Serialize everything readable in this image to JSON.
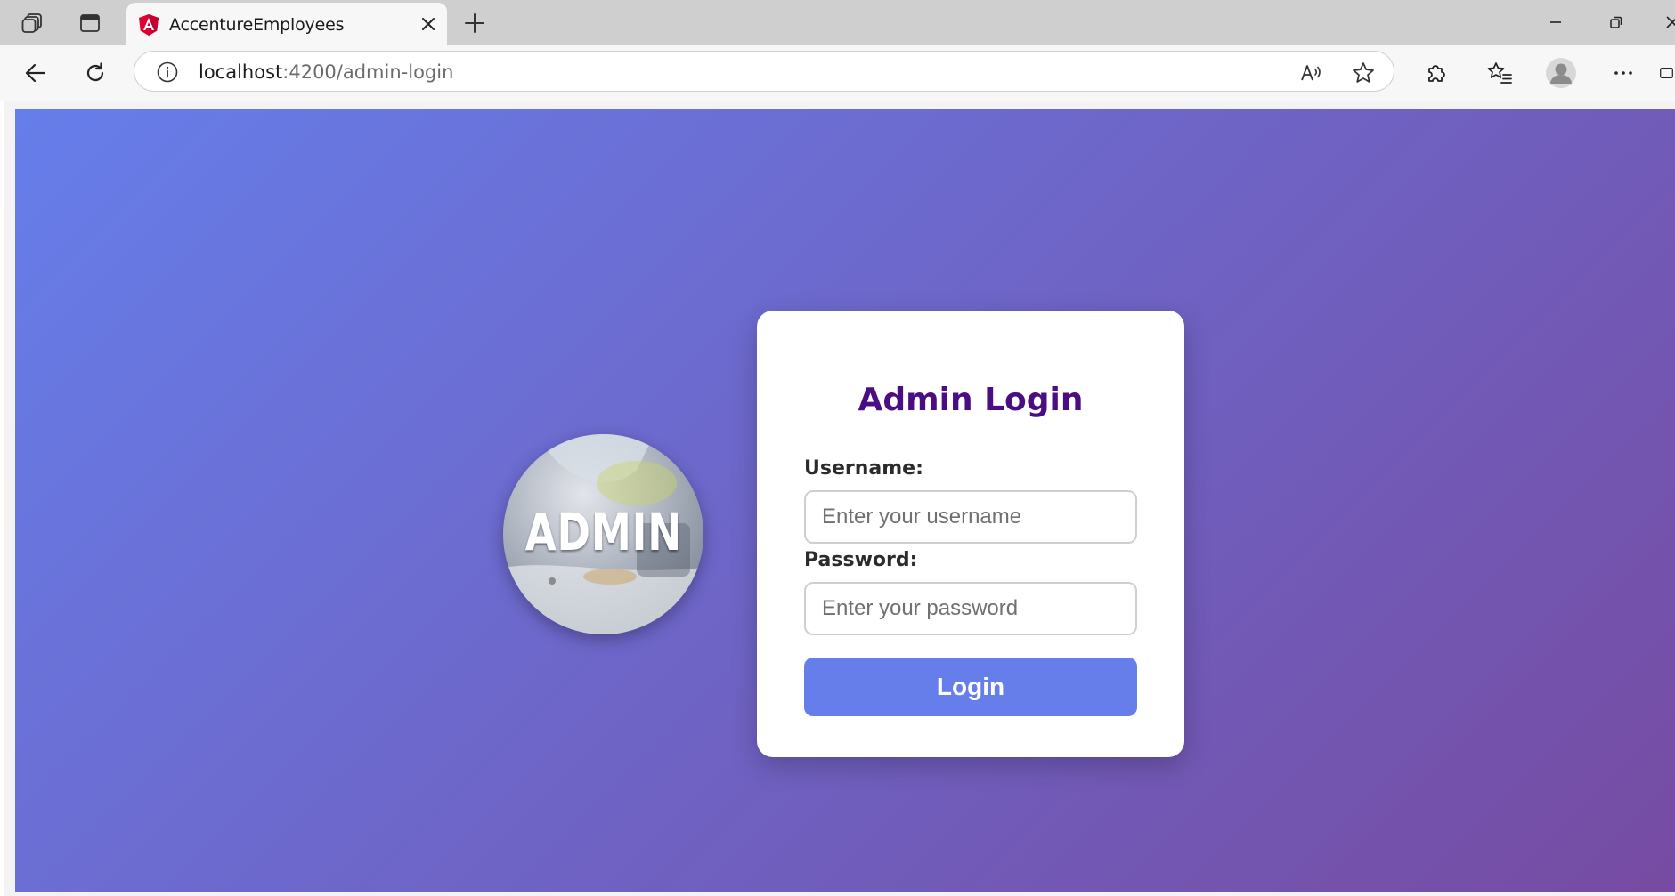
{
  "browser": {
    "tab": {
      "title": "AccentureEmployees"
    },
    "address": {
      "host": "localhost",
      "path": ":4200/admin-login"
    },
    "icons": {
      "workspaces": "workspaces-icon",
      "tab_actions": "tab-actions-icon",
      "favicon": "angular-favicon-icon",
      "close": "close-icon",
      "new_tab": "plus-icon",
      "back": "back-arrow-icon",
      "refresh": "refresh-icon",
      "info": "info-icon",
      "read_aloud": "read-aloud-icon",
      "favorite": "star-icon",
      "extensions": "puzzle-icon",
      "favorites": "favorites-list-icon",
      "profile": "profile-avatar-icon",
      "more": "more-icon"
    }
  },
  "page": {
    "avatar_text": "ADMIN",
    "login": {
      "title": "Admin Login",
      "username_label": "Username:",
      "username_placeholder": "Enter your username",
      "password_label": "Password:",
      "password_placeholder": "Enter your password",
      "button_label": "Login"
    }
  },
  "colors": {
    "gradient_start": "#667eea",
    "gradient_end": "#764ba2",
    "title": "#4b0d84",
    "button": "#667eea"
  }
}
